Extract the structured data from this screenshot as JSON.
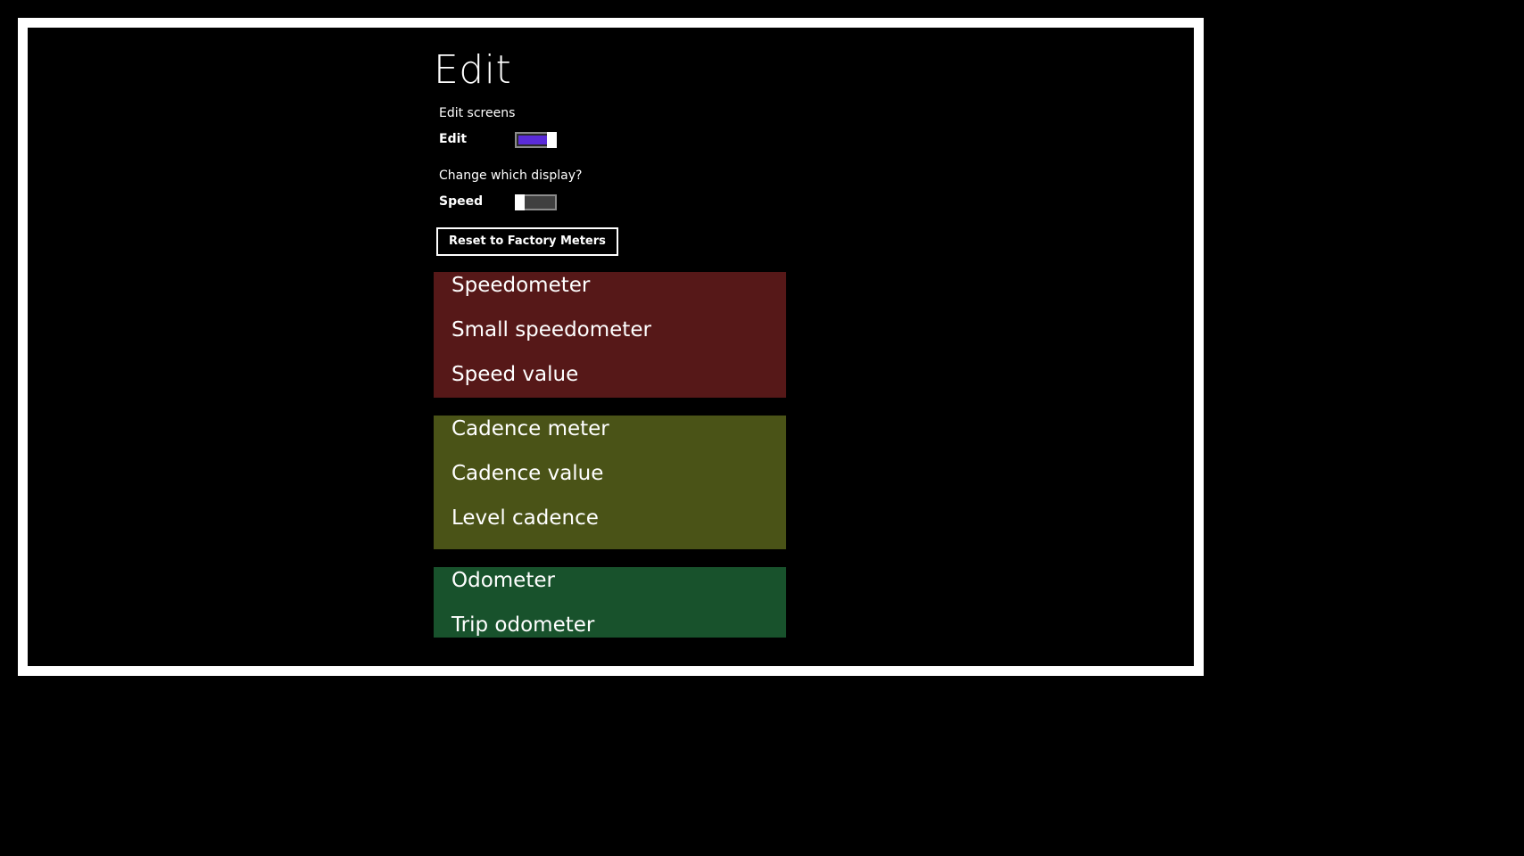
{
  "page": {
    "title": "Edit"
  },
  "edit_section": {
    "heading": "Edit screens",
    "toggle_label": "Edit",
    "toggle_state": "on"
  },
  "display_section": {
    "heading": "Change which display?",
    "toggle_label": "Speed",
    "toggle_state": "off"
  },
  "reset_button": {
    "label": "Reset to Factory Meters"
  },
  "meter_groups": [
    {
      "color": "#561818",
      "items": [
        "Speedometer",
        "Small speedometer",
        "Speed value"
      ]
    },
    {
      "color": "#4a5317",
      "items": [
        "Cadence meter",
        "Cadence value",
        "Level cadence"
      ]
    },
    {
      "color": "#18522c",
      "items": [
        "Odometer",
        "Trip odometer"
      ]
    }
  ],
  "colors": {
    "background": "#000000",
    "frame_border": "#ffffff",
    "toggle_on_accent": "#5a2bd8"
  }
}
